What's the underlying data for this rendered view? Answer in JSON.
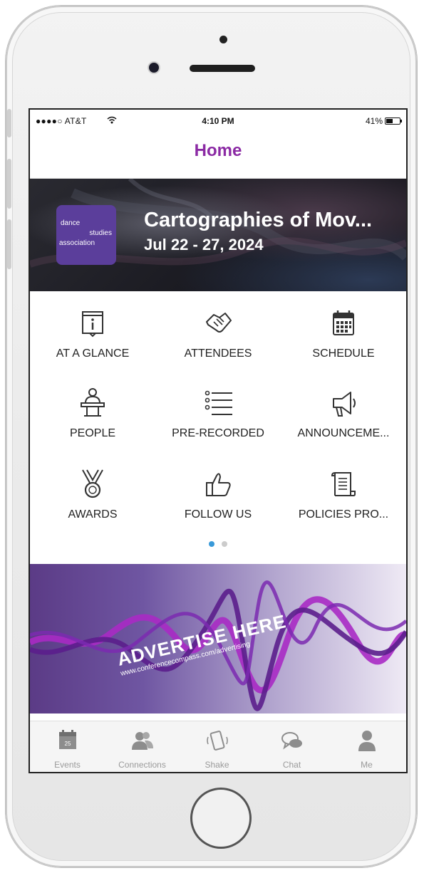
{
  "status_bar": {
    "carrier": "●●●●○ AT&T",
    "time": "4:10 PM",
    "battery": "41%"
  },
  "header": {
    "title": "Home"
  },
  "banner": {
    "event_name": "Cartographies of Mov...",
    "dates": "Jul 22 - 27, 2024",
    "logo_lines": [
      "dance",
      "studies",
      "association"
    ]
  },
  "grid": {
    "items": [
      {
        "label": "AT A GLANCE",
        "icon": "info-icon"
      },
      {
        "label": "ATTENDEES",
        "icon": "handshake-icon"
      },
      {
        "label": "SCHEDULE",
        "icon": "calendar-icon"
      },
      {
        "label": "PEOPLE",
        "icon": "speaker-podium-icon"
      },
      {
        "label": "PRE-RECORDED",
        "icon": "list-icon"
      },
      {
        "label": "ANNOUNCEME...",
        "icon": "megaphone-icon"
      },
      {
        "label": "AWARDS",
        "icon": "medal-icon"
      },
      {
        "label": "FOLLOW US",
        "icon": "thumbs-up-icon"
      },
      {
        "label": "POLICIES PRO...",
        "icon": "document-icon"
      }
    ],
    "page_index": 0,
    "page_count": 2
  },
  "ad": {
    "headline": "ADVERTISE HERE",
    "url": "www.conferencecompass.com/advertising"
  },
  "tabbar": {
    "tabs": [
      {
        "label": "Events",
        "icon": "calendar-icon",
        "badge": "25"
      },
      {
        "label": "Connections",
        "icon": "people-icon"
      },
      {
        "label": "Shake",
        "icon": "shake-phone-icon"
      },
      {
        "label": "Chat",
        "icon": "chat-bubbles-icon"
      },
      {
        "label": "Me",
        "icon": "person-icon"
      }
    ]
  },
  "colors": {
    "accent": "#8b2aa4",
    "dot_active": "#3a9ad9",
    "dot_inactive": "#cccccc",
    "tab_label": "#9a9a9a"
  }
}
